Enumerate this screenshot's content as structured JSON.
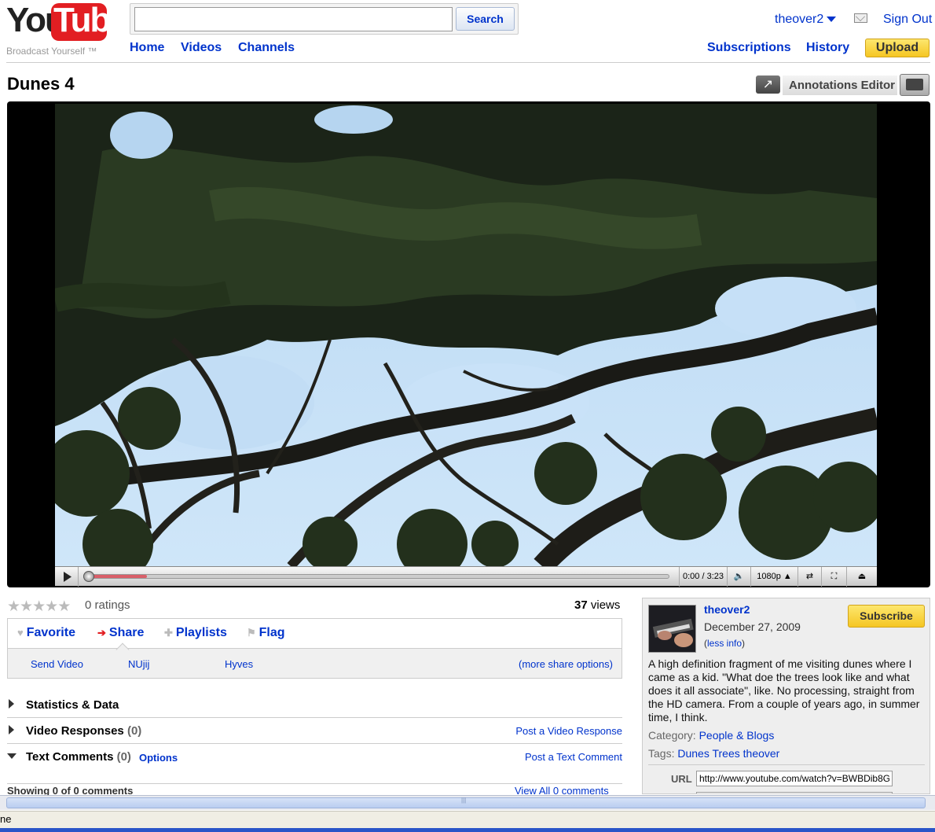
{
  "header": {
    "logo_you": "You",
    "logo_tube": "Tube",
    "logo_tagline": "Broadcast Yourself ™",
    "search_value": "",
    "search_button": "Search",
    "nav": [
      "Home",
      "Videos",
      "Channels"
    ],
    "username": "theover2",
    "sign_out": "Sign Out",
    "subscriptions": "Subscriptions",
    "history": "History",
    "upload": "Upload"
  },
  "video": {
    "title": "Dunes 4",
    "annotations_editor": "Annotations Editor",
    "time": "0:00 / 3:23",
    "quality": "1080p",
    "buffered_fraction": 0.1
  },
  "stats": {
    "ratings": "0 ratings",
    "views_count": "37",
    "views_label": "views"
  },
  "actions": {
    "favorite": "Favorite",
    "share": "Share",
    "playlists": "Playlists",
    "flag": "Flag",
    "share_targets": [
      "Send Video",
      "NUjij",
      "Hyves"
    ],
    "more_share": "(more share options)"
  },
  "sections": {
    "statistics": "Statistics & Data",
    "responses_label": "Video Responses",
    "responses_count": "(0)",
    "post_response": "Post a Video Response",
    "comments_label": "Text Comments",
    "comments_count": "(0)",
    "comments_options": "Options",
    "post_comment": "Post a Text Comment",
    "showing": "Showing 0 of 0 comments",
    "view_all": "View All 0 comments"
  },
  "info": {
    "uploader": "theover2",
    "date": "December 27, 2009",
    "less_info": "less info",
    "subscribe": "Subscribe",
    "description": "A high definition fragment of me visiting dunes where I came as a kid. \"What doe the trees look like and what does it all associate\", like. No processing, straight from the HD camera. From a couple of years ago, in summer time, I think.",
    "category_label": "Category:",
    "category": "People & Blogs",
    "tags_label": "Tags:",
    "tags": [
      "Dunes",
      "Trees",
      "theover"
    ],
    "url_label": "URL",
    "url": "http://www.youtube.com/watch?v=BWBDib8G"
  },
  "browser": {
    "status": "ne"
  },
  "colors": {
    "link": "#0033cc",
    "brand_red": "#e21e22",
    "button_yellow": "#f5c623"
  }
}
